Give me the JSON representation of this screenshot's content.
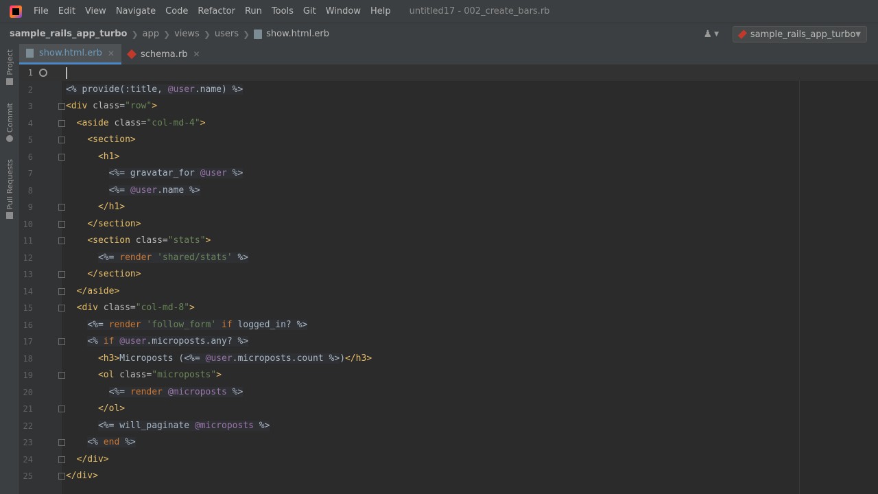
{
  "menubar": {
    "items": [
      "File",
      "Edit",
      "View",
      "Navigate",
      "Code",
      "Refactor",
      "Run",
      "Tools",
      "Git",
      "Window",
      "Help"
    ],
    "window_title": "untitled17 - 002_create_bars.rb"
  },
  "navbar": {
    "project": "sample_rails_app_turbo",
    "crumbs": [
      "app",
      "views",
      "users"
    ],
    "file": "show.html.erb",
    "run_config": "sample_rails_app_turbo"
  },
  "tool_windows": [
    "Project",
    "Commit",
    "Pull Requests"
  ],
  "tabs": [
    {
      "label": "show.html.erb",
      "active": true
    },
    {
      "label": "schema.rb",
      "active": false
    }
  ],
  "editor": {
    "current_line": 1,
    "lines": [
      "",
      "<% provide(:title, @user.name) %>",
      "<div class=\"row\">",
      "  <aside class=\"col-md-4\">",
      "    <section>",
      "      <h1>",
      "        <%= gravatar_for @user %>",
      "        <%= @user.name %>",
      "      </h1>",
      "    </section>",
      "    <section class=\"stats\">",
      "      <%= render 'shared/stats' %>",
      "    </section>",
      "  </aside>",
      "  <div class=\"col-md-8\">",
      "    <%= render 'follow_form' if logged_in? %>",
      "    <% if @user.microposts.any? %>",
      "      <h3>Microposts (<%= @user.microposts.count %>)</h3>",
      "      <ol class=\"microposts\">",
      "        <%= render @microposts %>",
      "      </ol>",
      "      <%= will_paginate @microposts %>",
      "    <% end %>",
      "  </div>",
      "</div>"
    ]
  }
}
